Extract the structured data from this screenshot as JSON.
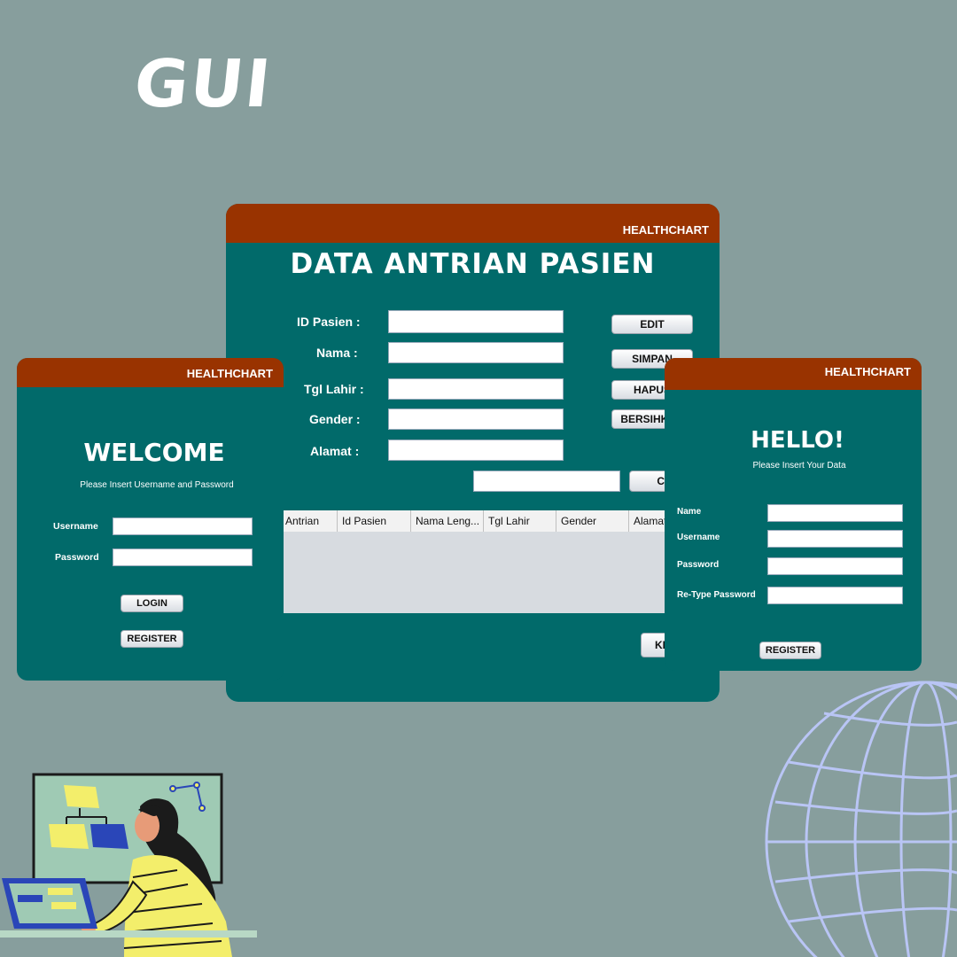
{
  "title": "GUI",
  "main_window": {
    "brand": "HEALTHCHART",
    "heading": "DATA ANTRIAN PASIEN",
    "labels": {
      "id_pasien": "ID Pasien :",
      "nama": "Nama :",
      "tgl_lahir": "Tgl Lahir :",
      "gender": "Gender :",
      "alamat": "Alamat :"
    },
    "buttons": {
      "edit": "EDIT",
      "simpan": "SIMPAN",
      "hapus": "HAPUS",
      "bersihkan": "BERSIHKAN",
      "cari": "CARI",
      "keluar": "KELUAR"
    },
    "table_columns": [
      "Antrian",
      "Id Pasien",
      "Nama Leng...",
      "Tgl Lahir",
      "Gender",
      "Alamat"
    ]
  },
  "login_window": {
    "brand": "HEALTHCHART",
    "heading": "WELCOME",
    "subtitle": "Please Insert Username and Password",
    "username_label": "Username",
    "password_label": "Password",
    "login_button": "LOGIN",
    "register_button": "REGISTER"
  },
  "register_window": {
    "brand": "HEALTHCHART",
    "heading": "HELLO!",
    "subtitle": "Please Insert Your Data",
    "name_label": "Name",
    "username_label": "Username",
    "password_label": "Password",
    "retype_label": "Re-Type Password",
    "register_button": "REGISTER"
  },
  "colors": {
    "background": "#879e9d",
    "window_teal": "#016a6a",
    "header_brown": "#993300",
    "globe": "#b9c5f5",
    "note_yellow": "#f3ee6b",
    "note_blue": "#2a46b8"
  },
  "icons": [
    "globe-icon",
    "person-at-laptop-illustration"
  ]
}
